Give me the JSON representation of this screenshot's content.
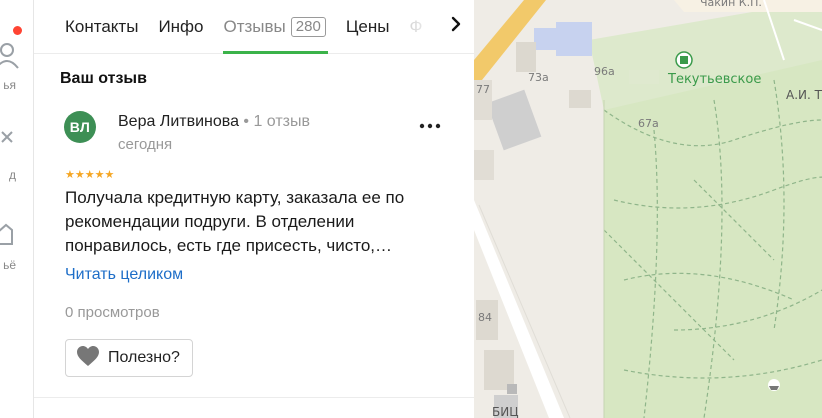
{
  "rail": {
    "labels": [
      "ья",
      "д",
      "ьё"
    ]
  },
  "tabs": [
    {
      "label": "Контакты"
    },
    {
      "label": "Инфо"
    },
    {
      "label": "Отзывы",
      "count": "280"
    },
    {
      "label": "Цены"
    },
    {
      "label": "Ф"
    }
  ],
  "review_section": {
    "title": "Ваш отзыв",
    "avatar_initials": "ВЛ",
    "author": "Вера Литвинова",
    "author_meta": " • 1 отзыв",
    "date": "сегодня",
    "more_label": "•••",
    "stars": "★★★★★",
    "text": "Получала кредитную карту, заказала ее по рекомендации подруги. В отделении понравилось, есть где присесть, чисто,…",
    "read_more": "Читать целиком",
    "views": "0 просмотров",
    "useful_label": "Полезно?"
  },
  "map": {
    "labels": {
      "chakin": "Чакин К.П.",
      "tekutevskoe": "Текутьевское",
      "ai_t": "А.И. Т",
      "n73a": "73а",
      "n96a": "96а",
      "n67a": "67а",
      "n77": "77",
      "n84": "84",
      "bic": "БИЦ"
    }
  },
  "colors": {
    "accent_green": "#3bb34a",
    "link_blue": "#1e6ec8",
    "avatar_green": "#3d8f55",
    "star": "#f5a623",
    "notification_red": "#ff4433"
  }
}
